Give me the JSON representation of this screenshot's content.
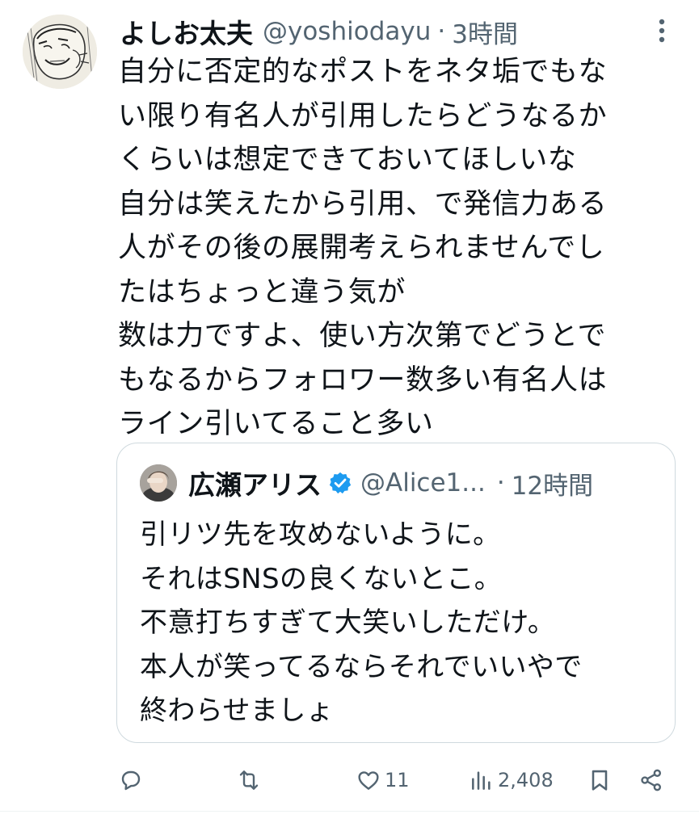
{
  "tweet": {
    "display_name": "よしお太夫",
    "handle": "@yoshiodayu",
    "separator": "·",
    "time": "3時間",
    "text_lines": [
      "自分に否定的なポストをネタ垢でもな",
      "い限り有名人が引用したらどうなるか",
      "くらいは想定できておいてほしいな",
      "自分は笑えたから引用、で発信力ある",
      "人がその後の展開考えられませんでし",
      "たはちょっと違う気が",
      "数は力ですよ、使い方次第でどうとで",
      "もなるからフォロワー数多い有名人は",
      "ライン引いてること多い"
    ]
  },
  "quote": {
    "display_name": "広瀬アリス",
    "handle": "@Alice1...",
    "separator": "·",
    "time": "12時間",
    "verified_icon": "verified-badge-icon",
    "text_lines": [
      "引リツ先を攻めないように。",
      "それはSNSの良くないとこ。",
      "不意打ちすぎて大笑いしただけ。",
      "本人が笑ってるならそれでいいやで",
      "終わらせましょ"
    ]
  },
  "actions": {
    "reply": {
      "icon": "reply-icon",
      "count": ""
    },
    "retweet": {
      "icon": "retweet-icon",
      "count": ""
    },
    "like": {
      "icon": "heart-icon",
      "count": "11"
    },
    "views": {
      "icon": "views-icon",
      "count": "2,408"
    },
    "bookmark": {
      "icon": "bookmark-icon"
    },
    "share": {
      "icon": "share-icon"
    }
  },
  "colors": {
    "text": "#0f1419",
    "secondary": "#536471",
    "border": "#cfd9de",
    "verified": "#1d9bf0"
  }
}
